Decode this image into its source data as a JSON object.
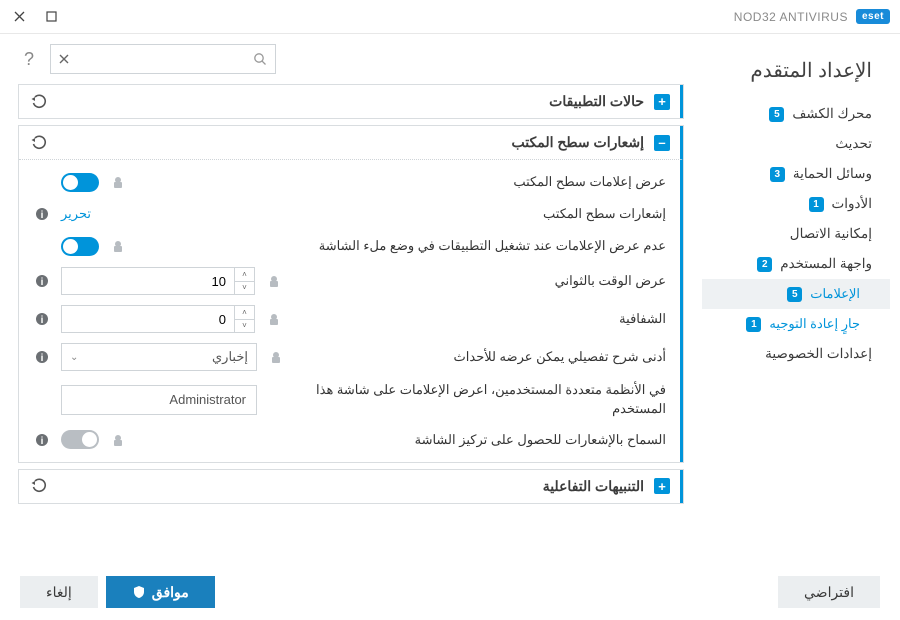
{
  "titlebar": {
    "product": "NOD32 ANTIVIRUS",
    "brand": "eset"
  },
  "page_title": "الإعداد المتقدم",
  "nav": [
    {
      "label": "محرك الكشف",
      "badge": "5"
    },
    {
      "label": "تحديث"
    },
    {
      "label": "وسائل الحماية",
      "badge": "3"
    },
    {
      "label": "الأدوات",
      "badge": "1"
    },
    {
      "label": "إمكانية الاتصال"
    },
    {
      "label": "واجهة المستخدم",
      "badge": "2"
    },
    {
      "label": "الإعلامات",
      "badge": "5",
      "active": true,
      "sub": true
    },
    {
      "label": "جارٍ إعادة التوجيه",
      "badge": "1",
      "sub": true,
      "link": true
    },
    {
      "label": "إعدادات الخصوصية"
    }
  ],
  "panels": {
    "app_states": {
      "title": "حالات التطبيقات"
    },
    "desktop": {
      "title": "إشعارات سطح المكتب",
      "rows": {
        "show": "عرض إعلامات سطح المكتب",
        "notif": "إشعارات سطح المكتب",
        "edit": "تحرير",
        "no_full": "عدم عرض الإعلامات عند تشغيل التطبيقات في وضع ملء الشاشة",
        "seconds": "عرض الوقت بالثواني",
        "seconds_val": "10",
        "trans": "الشفافية",
        "trans_val": "0",
        "min_verb": "أدنى شرح تفصيلي يمكن عرضه للأحداث",
        "min_verb_val": "إخباري",
        "multiuser": "في الأنظمة متعددة المستخدمين، اعرض الإعلامات على شاشة هذا المستخدم",
        "multiuser_val": "Administrator",
        "focus": "السماح بالإشعارات للحصول على تركيز الشاشة"
      }
    },
    "interactive": {
      "title": "التنبيهات التفاعلية"
    }
  },
  "footer": {
    "default": "افتراضي",
    "ok": "موافق",
    "cancel": "إلغاء"
  }
}
